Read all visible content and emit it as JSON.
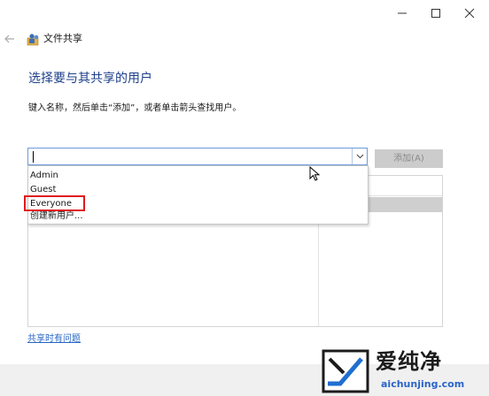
{
  "window": {
    "title": "文件共享",
    "controls": [
      "minimize-icon",
      "maximize-icon",
      "close-icon"
    ]
  },
  "header": {
    "title": "选择要与其共享的用户",
    "instruction": "键入名称，然后单击“添加”，或者单击箭头查找用户。"
  },
  "user_input": {
    "value": "",
    "options": [
      "Admin",
      "Guest",
      "Everyone",
      "创建新用户..."
    ],
    "highlighted_option": "Everyone"
  },
  "add_button_label": "添加(A)",
  "help_link": "共享时有问题",
  "watermark": {
    "name": "爱纯净",
    "url": "aichunjing.com"
  },
  "colors": {
    "heading": "#1e3f8a",
    "link": "#2765c4",
    "highlight_box": "#e0191d",
    "combo_border": "#6d9ad8"
  }
}
